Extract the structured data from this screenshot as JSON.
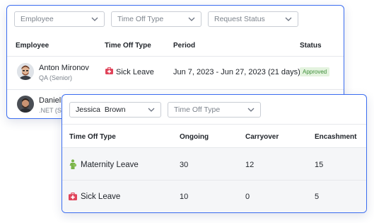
{
  "requests_panel": {
    "filters": {
      "employee_placeholder": "Employee",
      "time_off_type_placeholder": "Time Off Type",
      "request_status_placeholder": "Request Status"
    },
    "columns": {
      "employee": "Employee",
      "time_off_type": "Time Off Type",
      "period": "Period",
      "status": "Status"
    },
    "rows": [
      {
        "name": "Anton Mironov",
        "role": "QA (Senior)",
        "type": "Sick Leave",
        "period": "Jun 7, 2023 - Jun 27, 2023",
        "duration": "(21 days)",
        "status": "Approved"
      },
      {
        "name": "Daniel",
        "role": ".NET (Se"
      }
    ]
  },
  "balance_panel": {
    "filters": {
      "employee_value": "Jessica  Brown",
      "time_off_type_placeholder": "Time Off Type"
    },
    "columns": {
      "type": "Time Off Type",
      "ongoing": "Ongoing",
      "carryover": "Carryover",
      "encashment": "Encashment"
    },
    "rows": [
      {
        "type": "Maternity Leave",
        "ongoing": "30",
        "carryover": "12",
        "encashment": "15",
        "icon": "maternity-icon"
      },
      {
        "type": "Sick Leave",
        "ongoing": "10",
        "carryover": "0",
        "encashment": "5",
        "icon": "medical-kit-icon"
      }
    ]
  },
  "colors": {
    "accent_border": "#3b6df0",
    "approved_text": "#3f8f3a",
    "approved_bg": "#e4f3df",
    "sick_icon": "#e0445a",
    "maternity_icon": "#7bb44a"
  }
}
